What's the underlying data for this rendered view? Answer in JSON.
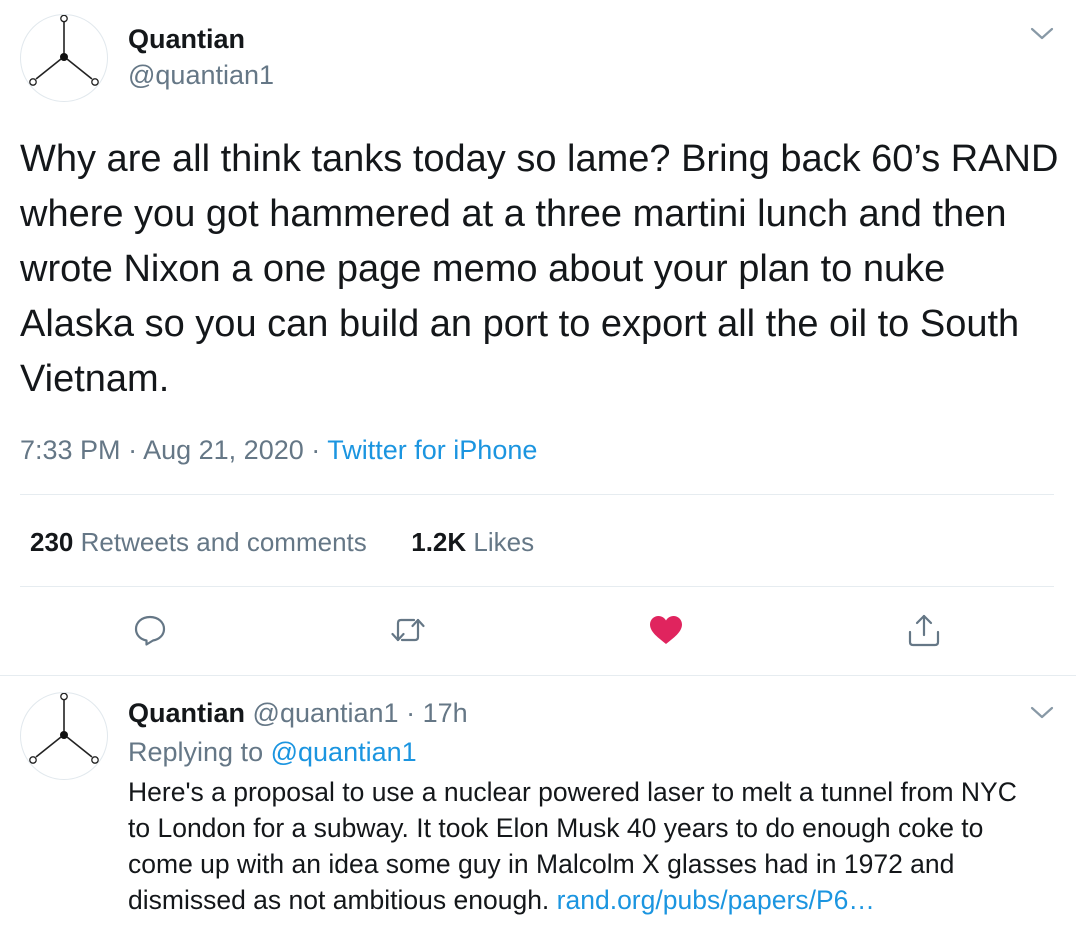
{
  "main_tweet": {
    "author_name": "Quantian",
    "author_handle": "@quantian1",
    "text": "Why are all think tanks today so lame?  Bring back 60’s RAND where you got hammered at a three martini lunch and then wrote Nixon a one page memo about your plan to nuke Alaska so you can build an port to export all the oil to South Vietnam.",
    "time": "7:33 PM",
    "separator": "·",
    "date": "Aug 21, 2020",
    "source": "Twitter for iPhone",
    "retweets_count": "230",
    "retweets_label": "Retweets and comments",
    "likes_count": "1.2K",
    "likes_label": "Likes",
    "liked": true,
    "icons": [
      "chevron-down-icon",
      "reply-icon",
      "retweet-icon",
      "heart-icon",
      "share-icon"
    ]
  },
  "reply_tweet": {
    "author_name": "Quantian",
    "author_handle": "@quantian1",
    "separator": "·",
    "age": "17h",
    "replying_prefix": "Replying to",
    "replying_to": "@quantian1",
    "text": "Here's a proposal to use a nuclear powered laser to melt a tunnel from NYC to London for a subway.  It took Elon Musk 40 years to do enough coke to come up with an idea some guy in Malcolm X glasses had in 1972 and dismissed as not ambitious enough.",
    "link": "rand.org/pubs/papers/P6…"
  },
  "colors": {
    "text": "#14171a",
    "secondary": "#657786",
    "link": "#1b95e0",
    "like": "#e0245e",
    "divider": "#e6ecf0"
  }
}
